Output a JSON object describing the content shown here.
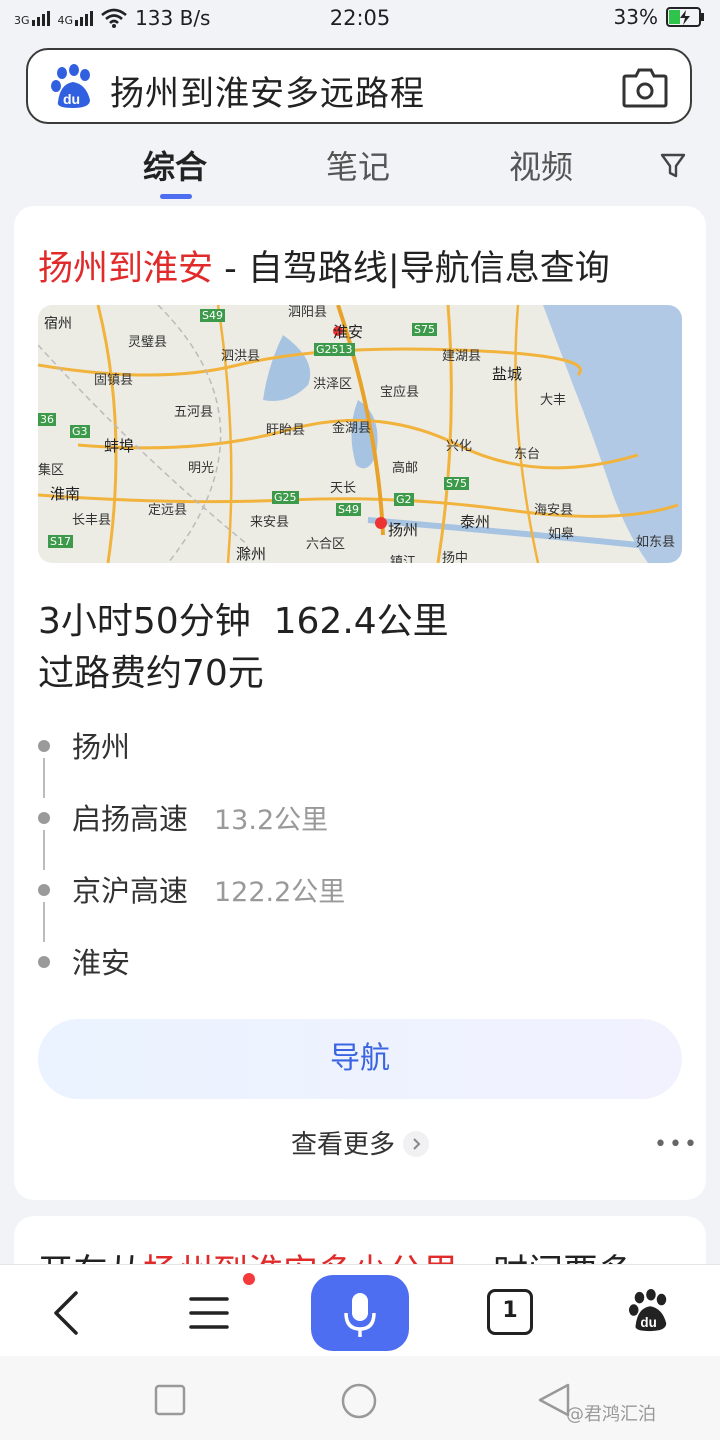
{
  "status_bar": {
    "signal_1": "3G",
    "signal_2": "4G",
    "speed": "133 B/s",
    "time": "22:05",
    "battery": "33%"
  },
  "search": {
    "query": "扬州到淮安多远路程",
    "logo_text": "du",
    "logo_icon": "baidu-paw-icon",
    "camera_icon": "camera-icon"
  },
  "tabs": [
    {
      "label": "综合",
      "active": true
    },
    {
      "label": "笔记",
      "active": false
    },
    {
      "label": "视频",
      "active": false
    }
  ],
  "filter_icon": "filter-icon",
  "result": {
    "title_highlight": "扬州到淮安",
    "title_rest": " - 自驾路线|导航信息查询",
    "map_labels": [
      "泗阳县",
      "宿州",
      "S49",
      "淮安",
      "S75",
      "灵璧县",
      "泗洪县",
      "G2513",
      "建湖县",
      "盐城",
      "固镇县",
      "洪泽区",
      "宝应县",
      "大丰",
      "五河县",
      "盱眙县",
      "金湖县",
      "G3",
      "兴化",
      "东台",
      "蚌埠",
      "明光",
      "高邮",
      "36",
      "集区",
      "S75",
      "淮南",
      "天长",
      "G25",
      "G2",
      "海安县",
      "长丰县",
      "定远县",
      "来安县",
      "S49",
      "扬州",
      "泰州",
      "如皋",
      "滁州",
      "六合区",
      "扬中",
      "如东县",
      "S17",
      "镇江"
    ],
    "route_time": "3小时50分钟",
    "route_distance": "162.4公里",
    "toll": "过路费约70元",
    "steps": [
      {
        "name": "扬州",
        "distance": ""
      },
      {
        "name": "启扬高速",
        "distance": "13.2公里"
      },
      {
        "name": "京沪高速",
        "distance": "122.2公里"
      },
      {
        "name": "淮安",
        "distance": ""
      }
    ],
    "nav_button": "导航",
    "more_label": "查看更多",
    "more_dots": "•••"
  },
  "next_result": {
    "prefix": "开车从",
    "highlight": "扬州到淮安多少公里",
    "suffix": "，时间要多"
  },
  "bottom_bar": {
    "back_icon": "back-arrow-icon",
    "menu_icon": "menu-icon",
    "mic_icon": "microphone-icon",
    "tabs_count": "1",
    "home_icon": "baidu-paw-icon",
    "home_logo_text": "du"
  },
  "system_nav": {
    "recent_icon": "square-icon",
    "home_icon": "circle-icon",
    "back_icon": "triangle-back-icon"
  },
  "watermark": "@君鸿汇泊"
}
